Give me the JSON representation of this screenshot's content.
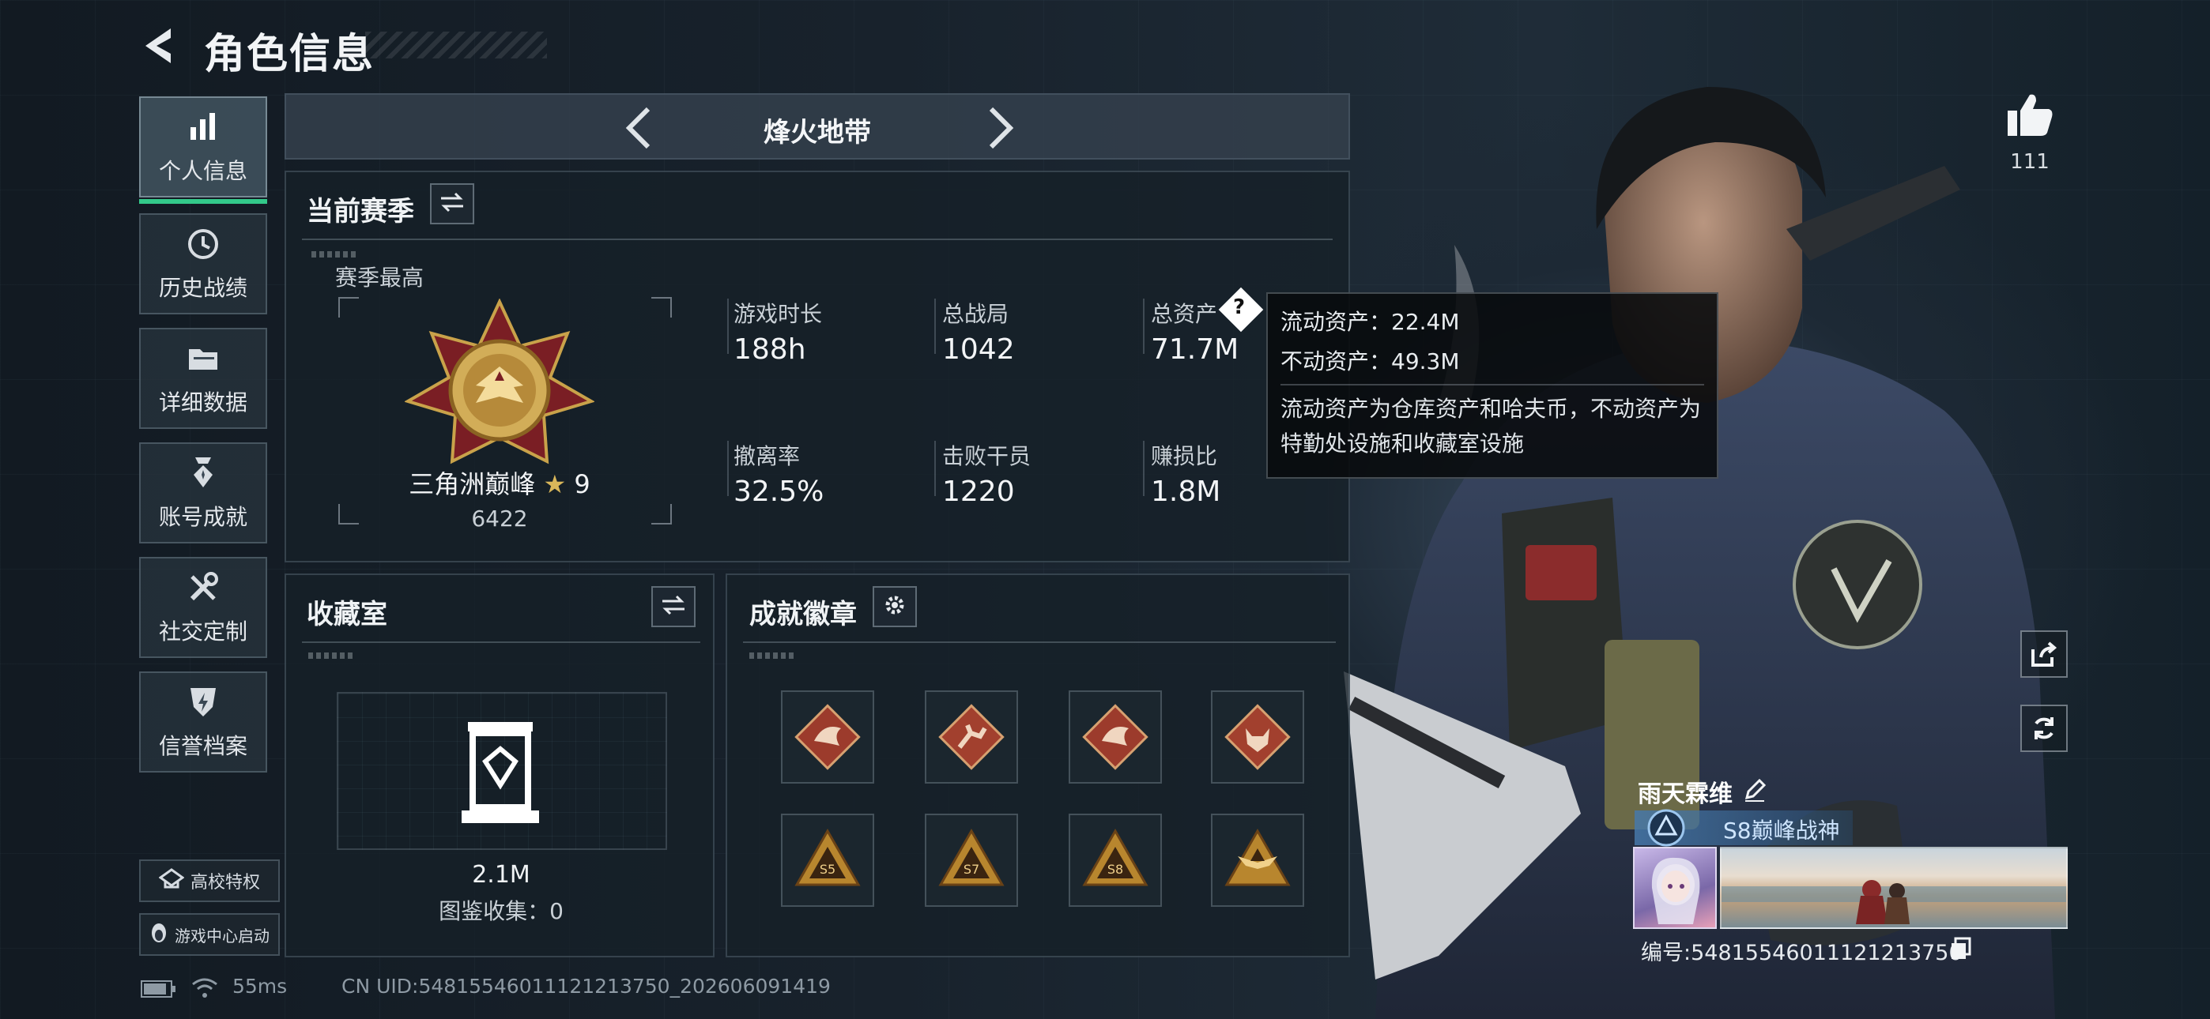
{
  "header": {
    "title": "角色信息"
  },
  "sidebar": {
    "items": [
      {
        "label": "个人信息",
        "icon": "bar-chart-icon",
        "active": true
      },
      {
        "label": "历史战绩",
        "icon": "history-clock-icon",
        "active": false
      },
      {
        "label": "详细数据",
        "icon": "folder-icon",
        "active": false
      },
      {
        "label": "账号成就",
        "icon": "achievement-medal-icon",
        "active": false
      },
      {
        "label": "社交定制",
        "icon": "tools-icon",
        "active": false
      },
      {
        "label": "信誉档案",
        "icon": "credit-shield-icon",
        "active": false
      }
    ],
    "campus_button": "高校特权",
    "game_center_button": "游戏中心启动"
  },
  "mode": {
    "label": "烽火地带"
  },
  "season": {
    "title": "当前赛季",
    "best_label": "赛季最高",
    "rank_name": "三角洲巅峰",
    "rank_stars": "9",
    "rank_score": "6422",
    "stats": [
      {
        "label": "游戏时长",
        "value": "188h"
      },
      {
        "label": "总战局",
        "value": "1042"
      },
      {
        "label": "总资产",
        "value": "71.7M"
      },
      {
        "label": "撤离率",
        "value": "32.5%"
      },
      {
        "label": "击败干员",
        "value": "1220"
      },
      {
        "label": "赚损比",
        "value": "1.8M"
      }
    ]
  },
  "tooltip": {
    "liquid": "流动资产：22.4M",
    "fixed": "不动资产：49.3M",
    "description": "流动资产为仓库资产和哈夫币，不动资产为特勤处设施和收藏室设施"
  },
  "collection": {
    "title": "收藏室",
    "value": "2.1M",
    "count_label": "图鉴收集：0"
  },
  "badges": {
    "title": "成就徽章",
    "items": [
      {
        "icon": "dragon-badge-icon",
        "color": "#9c3b2c"
      },
      {
        "icon": "runner-badge-icon",
        "color": "#a2402e"
      },
      {
        "icon": "dragon-badge-icon",
        "color": "#9c3b2c"
      },
      {
        "icon": "wolf-badge-icon",
        "color": "#a2402e"
      },
      {
        "icon": "s5-triangle-badge-icon",
        "color": "#b8862e"
      },
      {
        "icon": "s7-triangle-badge-icon",
        "color": "#b8862e"
      },
      {
        "icon": "s8-triangle-badge-icon",
        "color": "#b8862e"
      },
      {
        "icon": "winged-triangle-badge-icon",
        "color": "#b8862e"
      }
    ]
  },
  "player": {
    "likes": "111",
    "name": "雨天霖维",
    "title": "S8巅峰战神",
    "uid_label": "编号:54815546011121213750"
  },
  "footer": {
    "ping": "55ms",
    "uid": "CN UID:54815546011121213750_202606091419"
  },
  "colors": {
    "accent_green": "#33c98a",
    "tooltip_bg": "#0a0c0e",
    "badge_red": "#9c3b2c",
    "badge_gold": "#b8862e"
  }
}
